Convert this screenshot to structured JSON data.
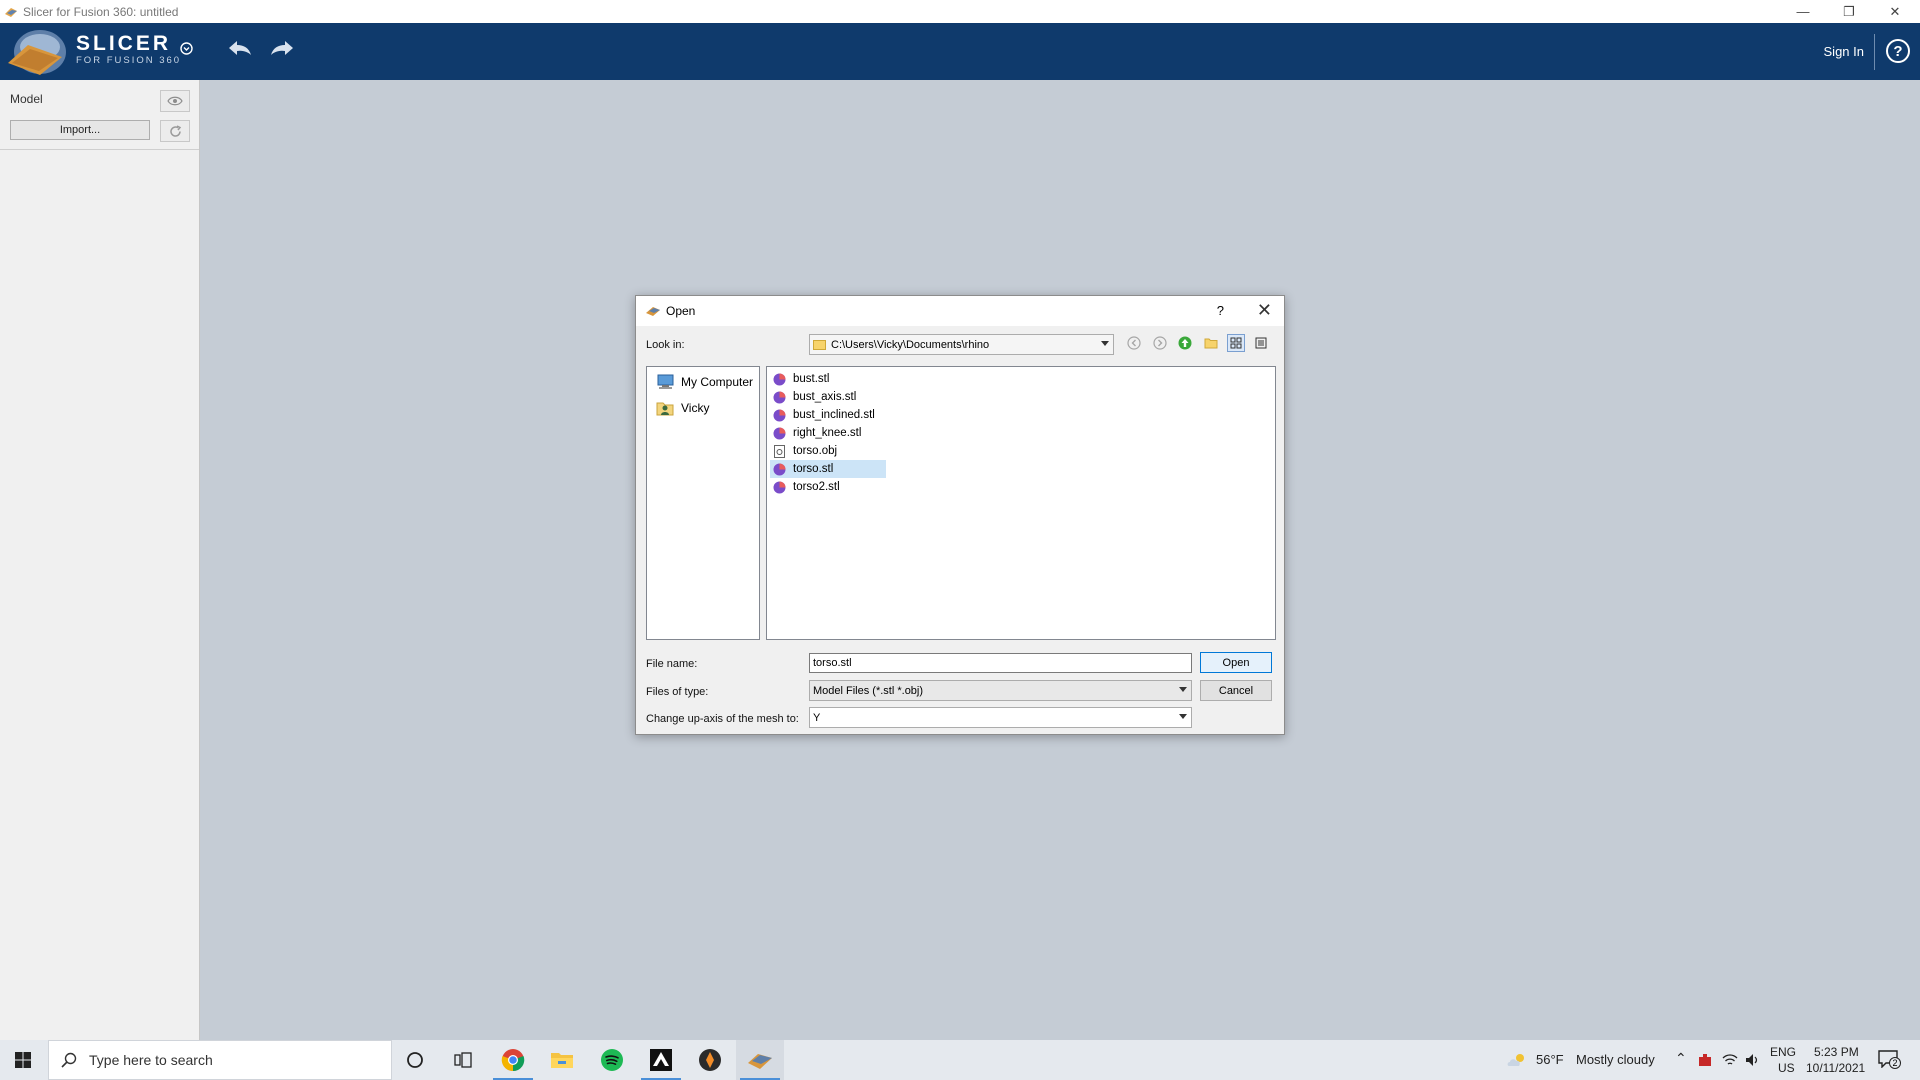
{
  "window": {
    "title": "Slicer for Fusion 360: untitled"
  },
  "header": {
    "logo_line1": "SLICER",
    "logo_line2": "FOR FUSION 360",
    "sign_in": "Sign In",
    "help": "?"
  },
  "panel": {
    "model_label": "Model",
    "import_label": "Import..."
  },
  "dialog": {
    "title": "Open",
    "help": "?",
    "look_in_label": "Look in:",
    "look_in_path": "C:\\Users\\Vicky\\Documents\\rhino",
    "sidebar": [
      {
        "label": "My Computer"
      },
      {
        "label": "Vicky"
      }
    ],
    "files": [
      {
        "name": "bust.stl",
        "type": "stl"
      },
      {
        "name": "bust_axis.stl",
        "type": "stl"
      },
      {
        "name": "bust_inclined.stl",
        "type": "stl"
      },
      {
        "name": "right_knee.stl",
        "type": "stl"
      },
      {
        "name": "torso.obj",
        "type": "obj"
      },
      {
        "name": "torso.stl",
        "type": "stl",
        "selected": true
      },
      {
        "name": "torso2.stl",
        "type": "stl"
      }
    ],
    "file_name_label": "File name:",
    "file_name_value": "torso.stl",
    "files_of_type_label": "Files of type:",
    "files_of_type_value": "Model Files (*.stl *.obj)",
    "up_axis_label": "Change up-axis of the mesh to:",
    "up_axis_value": "Y",
    "open_button": "Open",
    "cancel_button": "Cancel"
  },
  "taskbar": {
    "search_placeholder": "Type here to search",
    "weather_temp": "56°F",
    "weather_desc": "Mostly cloudy",
    "lang_line1": "ENG",
    "lang_line2": "US",
    "time": "5:23 PM",
    "date": "10/11/2021",
    "notification_count": "2"
  },
  "colors": {
    "header_bg": "#0f3a6c",
    "selection": "#cce4f7",
    "stl_icon": "#7a4cc9",
    "accent": "#0078d7"
  }
}
